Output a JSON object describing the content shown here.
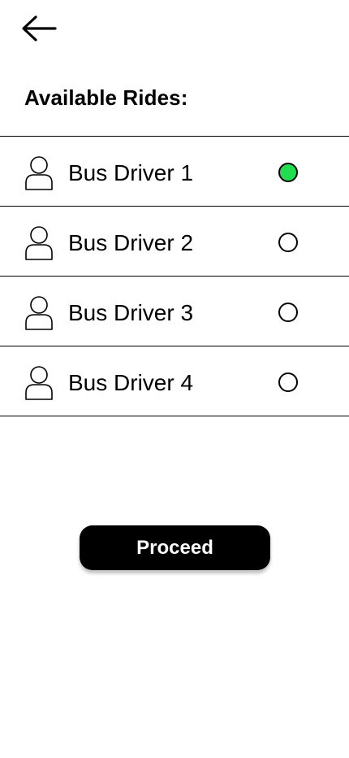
{
  "header": {
    "back_icon": "arrow-left-icon",
    "title": "Available Rides:"
  },
  "rides": [
    {
      "name": "Bus Driver 1",
      "icon": "person-icon",
      "selected": true
    },
    {
      "name": "Bus Driver 2",
      "icon": "person-icon",
      "selected": false
    },
    {
      "name": "Bus Driver 3",
      "icon": "person-icon",
      "selected": false
    },
    {
      "name": "Bus Driver 4",
      "icon": "person-icon",
      "selected": false
    }
  ],
  "actions": {
    "proceed_label": "Proceed"
  },
  "colors": {
    "selected_radio": "#22dd4f",
    "button_bg": "#000000",
    "button_text": "#ffffff"
  }
}
